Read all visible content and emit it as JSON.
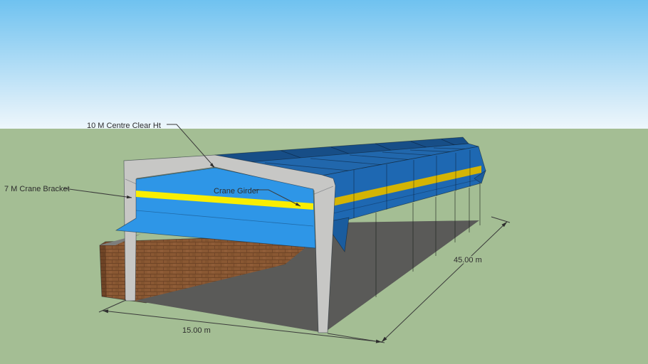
{
  "viewport": {
    "labels": {
      "clear_height": "10 M Centre Clear Ht",
      "crane_bracket": "7 M Crane Bracket",
      "crane_girder": "Crane Girder"
    },
    "dimensions": {
      "length": "45.00 m",
      "width": "15.00 m"
    },
    "colors": {
      "sky_top": "#6fc2f0",
      "sky_mid": "#d9edf9",
      "sky_horizon": "#eef7fc",
      "ground": "#a4be94",
      "roof_far_plane": "#174e87",
      "roof_near_plane": "#2167ac",
      "side_wall": "#1e68b2",
      "side_wall_skirt": "#1a5c9e",
      "gable_wall": "#2e96e7",
      "crane_girder_side": "#d4b404",
      "crane_girder_gable": "#f9ee00",
      "steel_frame": "#c7c7c5",
      "brick_wall": "#8a5833",
      "ground_shadow": "#5a5a58"
    }
  }
}
